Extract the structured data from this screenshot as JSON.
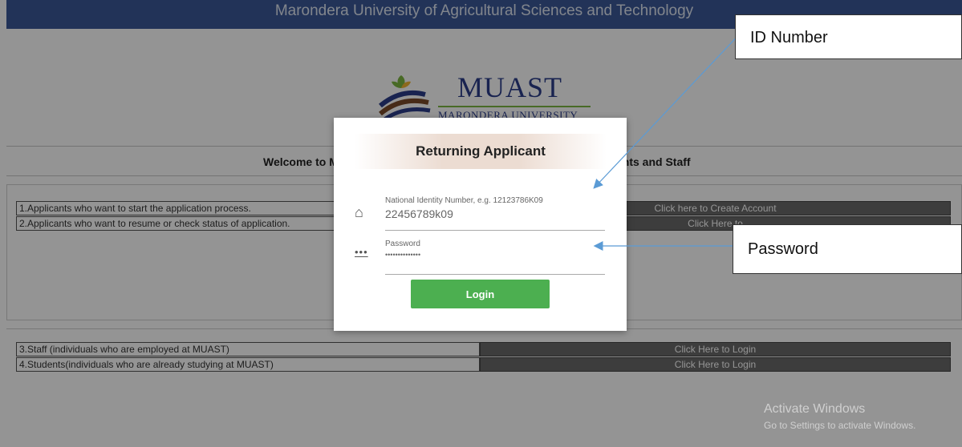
{
  "header": {
    "title": "Marondera University of Agricultural Sciences and Technology"
  },
  "logo": {
    "name": "MUAST",
    "subtitle": "MARONDERA UNIVERSITY"
  },
  "welcome": {
    "left": "Welcome to M",
    "right": "ents and Staff"
  },
  "rows": [
    {
      "label": "1.Applicants who want to start the application process.",
      "action": "Click here to Create Account"
    },
    {
      "label": "2.Applicants who want to resume or check status of application.",
      "action": "Click Here to"
    },
    {
      "label": "3.Staff (individuals who are employed at MUAST)",
      "action": "Click Here to Login"
    },
    {
      "label": "4.Students(individuals who are already studying at MUAST)",
      "action": "Click Here to Login"
    }
  ],
  "modal": {
    "title": "Returning Applicant",
    "id_field": {
      "label": "National Identity Number, e.g. 12123786K09",
      "value": "22456789k09",
      "icon": "home-icon"
    },
    "password_field": {
      "label": "Password",
      "value": "••••••••••••••",
      "icon": "dots-icon"
    },
    "login_label": "Login"
  },
  "callouts": {
    "id": "ID Number",
    "password": "Password"
  },
  "watermark": {
    "title": "Activate Windows",
    "subtitle": "Go to Settings to activate Windows."
  },
  "colors": {
    "header": "#3b5998",
    "login_button": "#4caf50",
    "row_action": "#6a6a6a"
  }
}
